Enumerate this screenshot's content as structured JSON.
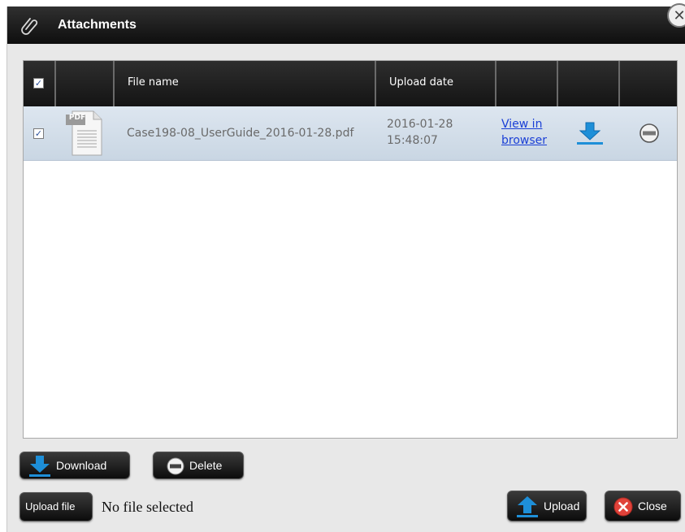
{
  "dialog": {
    "title": "Attachments",
    "title_icon": "paperclip-icon",
    "close_icon": "close-icon"
  },
  "grid": {
    "columns": [
      "",
      "",
      "File name",
      "Upload date",
      "",
      "",
      ""
    ],
    "select_all_checked": true,
    "rows": [
      {
        "checked": true,
        "file_type_badge": "PDF",
        "file_name": "Case198-08_UserGuide_2016-01-28.pdf",
        "upload_date": "2016-01-28",
        "upload_time": "15:48:07",
        "view_link_line1": "View in",
        "view_link_line2": "browser",
        "download_icon": "download-icon",
        "delete_icon": "minus-circle-icon"
      }
    ]
  },
  "buttons": {
    "download": "Download",
    "delete": "Delete",
    "upload_file": "Upload file",
    "upload": "Upload",
    "close": "Close"
  },
  "file_input": {
    "status_text": "No file selected"
  },
  "colors": {
    "titlebar": "#1a1a1a",
    "row_highlight": "#d3dde8",
    "link": "#1a3fd6",
    "download_blue": "#1e8fd8",
    "close_red": "#e0423a"
  }
}
